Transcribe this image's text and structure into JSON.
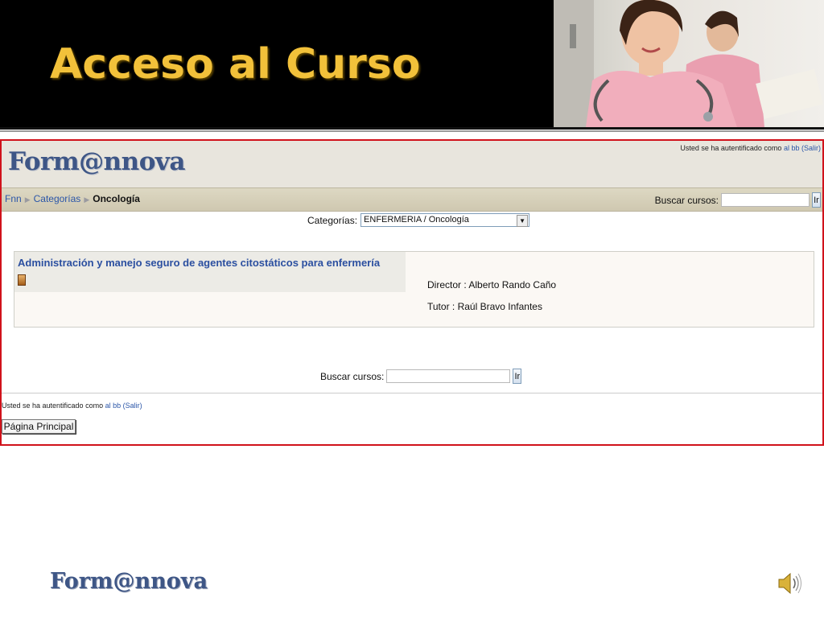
{
  "slide": {
    "title": "Acceso al Curso",
    "bottom_logo": "Form@nnova"
  },
  "site": {
    "logo": "Form@nnova",
    "login_top": {
      "prefix": "Usted se ha autentificado como",
      "user": "al bb",
      "logout": "(Salir)"
    },
    "breadcrumb": {
      "home": "Fnn",
      "categories": "Categorías",
      "current": "Oncología"
    },
    "search_top": {
      "label": "Buscar cursos:",
      "value": "",
      "button": "Ir"
    },
    "category_select": {
      "label": "Categorías:",
      "selected": "ENFERMERIA / Oncología"
    },
    "course": {
      "title": "Administración y manejo seguro de agentes citostáticos para enfermería",
      "director": "Director : Alberto Rando Caño",
      "tutor": "Tutor : Raúl Bravo Infantes"
    },
    "search_mid": {
      "label": "Buscar cursos:",
      "value": "",
      "button": "Ir"
    },
    "login_bottom": {
      "prefix": "Usted se ha autentificado como",
      "user": "al bb",
      "logout": "(Salir)"
    },
    "home_button": "Página Principal"
  },
  "icons": {
    "course": "course-icon",
    "speaker": "speaker-icon",
    "dropdown": "chevron-down-icon"
  },
  "colors": {
    "title": "#f2c13a",
    "frame_border": "#d0121b",
    "link": "#2b56a8",
    "logo": "#3e5686"
  }
}
